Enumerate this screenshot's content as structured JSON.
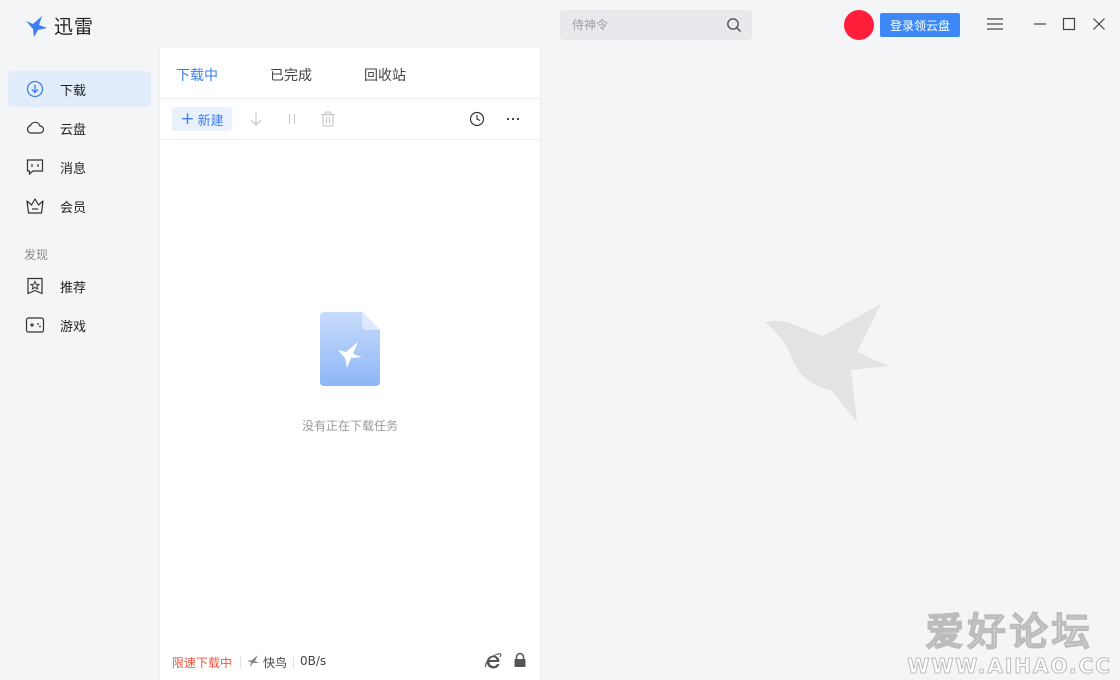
{
  "app": {
    "title": "迅雷"
  },
  "search": {
    "placeholder": "侍神令"
  },
  "header": {
    "login_label": "登录领云盘",
    "avatar_color": "#ff1f3a"
  },
  "sidebar": {
    "items": [
      {
        "label": "下载",
        "icon": "download-circle-icon",
        "active": true
      },
      {
        "label": "云盘",
        "icon": "cloud-icon"
      },
      {
        "label": "消息",
        "icon": "message-icon"
      },
      {
        "label": "会员",
        "icon": "crown-icon"
      }
    ],
    "section_title": "发现",
    "discover_items": [
      {
        "label": "推荐",
        "icon": "star-bookmark-icon"
      },
      {
        "label": "游戏",
        "icon": "gamepad-icon"
      }
    ]
  },
  "tabs": [
    {
      "label": "下载中",
      "active": true
    },
    {
      "label": "已完成"
    },
    {
      "label": "回收站"
    }
  ],
  "toolbar": {
    "new_label": "新建"
  },
  "empty": {
    "text": "没有正在下载任务"
  },
  "status": {
    "limit": "限速下载中",
    "kuainiao": "快鸟",
    "speed": "0B/s"
  },
  "watermark": {
    "cn": "爱好论坛",
    "url": "WWW.AIHAO.CC"
  },
  "colors": {
    "accent": "#3d7ef0",
    "login_bg": "#3d88f6",
    "warning": "#f0553a"
  }
}
